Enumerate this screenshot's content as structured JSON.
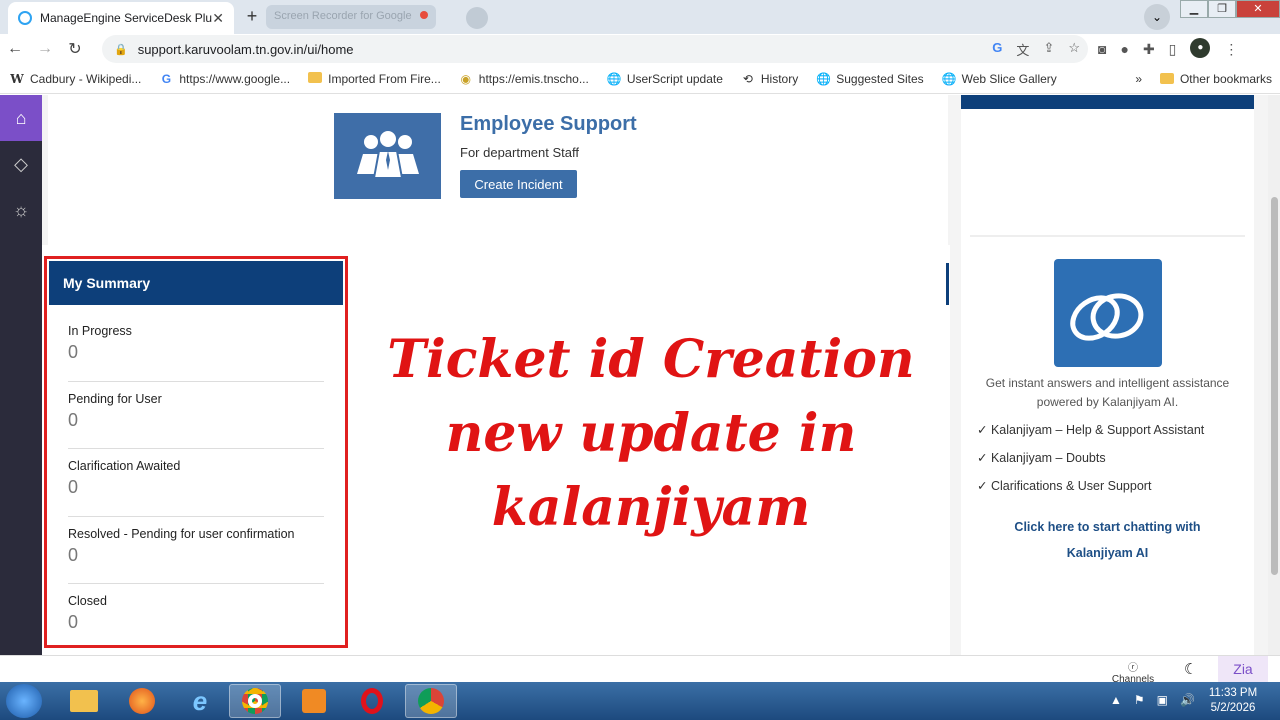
{
  "browser": {
    "active_tab_title": "ManageEngine ServiceDesk Plus",
    "inactive_tab_title": "Screen Recorder for Google",
    "url": "support.karuvoolam.tn.gov.in/ui/home",
    "bookmarks": [
      {
        "label": "Cadbury - Wikipedi...",
        "icon": "wikipedia-icon"
      },
      {
        "label": "https://www.google...",
        "icon": "google-icon"
      },
      {
        "label": "Imported From Fire...",
        "icon": "folder-icon"
      },
      {
        "label": "https://emis.tnscho...",
        "icon": "emis-icon"
      },
      {
        "label": "UserScript update",
        "icon": "globe-icon"
      },
      {
        "label": "History",
        "icon": "history-icon"
      },
      {
        "label": "Suggested Sites",
        "icon": "globe-icon"
      },
      {
        "label": "Web Slice Gallery",
        "icon": "globe-icon"
      }
    ],
    "other_bookmarks": "Other bookmarks",
    "more_bookmarks": "»"
  },
  "employee_support": {
    "title": "Employee Support",
    "subtitle": "For department Staff",
    "button": "Create Incident"
  },
  "summary": {
    "title": "My Summary",
    "rows": [
      {
        "label": "In Progress",
        "value": "0"
      },
      {
        "label": "Pending for User",
        "value": "0"
      },
      {
        "label": "Clarification Awaited",
        "value": "0"
      },
      {
        "label": "Resolved - Pending for user confirmation",
        "value": "0"
      },
      {
        "label": "Closed",
        "value": "0"
      }
    ]
  },
  "overlay": {
    "line1": "Ticket id Creation",
    "line2": "new update in",
    "line3": "kalanjiyam"
  },
  "ai_panel": {
    "desc_line1": "Get instant answers and intelligent assistance",
    "desc_line2": "powered by Kalanjiyam AI.",
    "items": [
      "✓ Kalanjiyam – Help & Support Assistant",
      "✓ Kalanjiyam – Doubts",
      "✓ Clarifications & User Support"
    ],
    "link_line1": "Click here to start chatting with",
    "link_line2": "Kalanjiyam AI"
  },
  "footer": {
    "channels": "Channels",
    "zia": "Zia"
  },
  "taskbar": {
    "time": "11:33 PM",
    "date": "5/2/2026"
  },
  "colors": {
    "brand_blue": "#0d3f7a",
    "accent_blue": "#3c6ea8",
    "highlight_red": "#e01414",
    "nav_purple": "#7b4fc8"
  }
}
